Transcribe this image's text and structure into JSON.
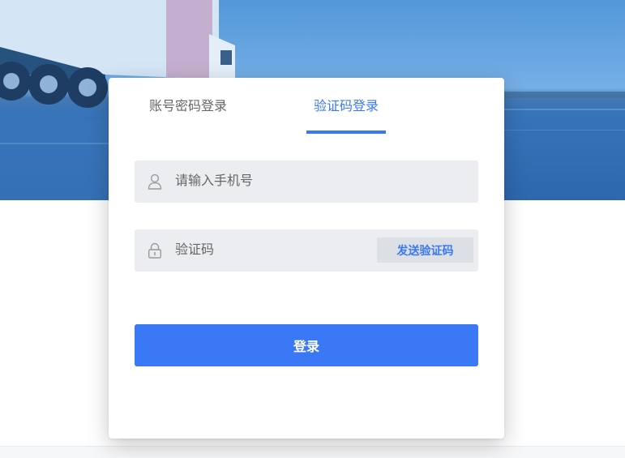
{
  "login_form": {
    "tabs": [
      {
        "label": "账号密码登录",
        "active": false
      },
      {
        "label": "验证码登录",
        "active": true
      }
    ],
    "phone": {
      "placeholder": "请输入手机号",
      "icon": "user-icon"
    },
    "code": {
      "placeholder": "验证码",
      "icon": "lock-icon",
      "send_label": "发送验证码"
    },
    "submit_label": "登录"
  },
  "colors": {
    "accent": "#3a78f5"
  }
}
